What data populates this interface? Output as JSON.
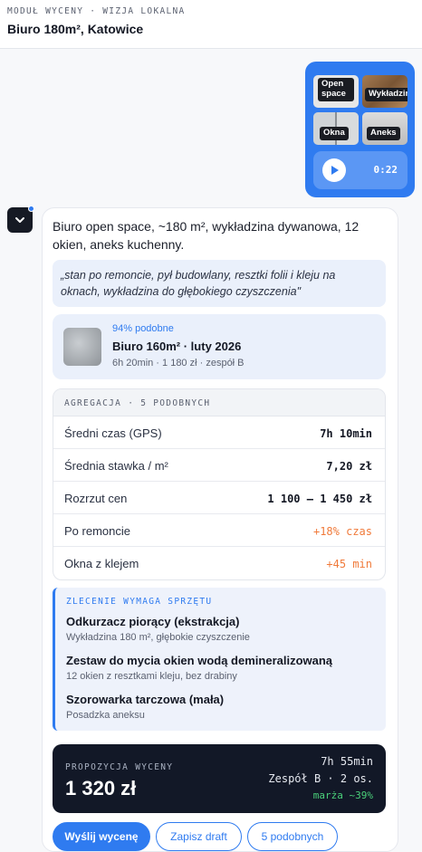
{
  "header": {
    "eyebrow": "MODUŁ WYCENY · WIZJA LOKALNA",
    "title": "Biuro 180m², Katowice"
  },
  "attachments": {
    "photos": [
      {
        "label": "Open space"
      },
      {
        "label": "Wykładzina"
      },
      {
        "label": "Okna"
      },
      {
        "label": "Aneks"
      }
    ],
    "audio": {
      "duration": "0:22"
    }
  },
  "assistant": {
    "intro": "Biuro open space, ~180 m², wykładzina dywanowa, 12 okien, aneks kuchenny.",
    "quote": "„stan po remoncie, pył budowlany, resztki folii i kleju na oknach, wykładzina do głębokiego czyszczenia\"",
    "match": {
      "similarity": "94% podobne",
      "name": "Biuro 160m² · luty 2026",
      "meta": "6h 20min · 1 180 zł · zespół B"
    },
    "aggregation": {
      "title": "AGREGACJA · 5 PODOBNYCH",
      "rows": [
        {
          "label": "Średni czas (GPS)",
          "value": "7h 10min"
        },
        {
          "label": "Średnia stawka / m²",
          "value": "7,20 zł"
        },
        {
          "label": "Rozrzut cen",
          "value": "1 100 – 1 450 zł"
        },
        {
          "label": "Po remoncie",
          "value": "+18% czas"
        },
        {
          "label": "Okna z klejem",
          "value": "+45 min"
        }
      ]
    },
    "equipment": {
      "title": "ZLECENIE WYMAGA SPRZĘTU",
      "items": [
        {
          "name": "Odkurzacz piorący (ekstrakcja)",
          "desc": "Wykładzina 180 m², głębokie czyszczenie"
        },
        {
          "name": "Zestaw do mycia okien wodą demineralizowaną",
          "desc": "12 okien z resztkami kleju, bez drabiny"
        },
        {
          "name": "Szorowarka tarczowa (mała)",
          "desc": "Posadzka aneksu"
        }
      ]
    },
    "proposal": {
      "label": "PROPOZYCJA WYCENY",
      "price": "1 320 zł",
      "time": "7h 55min",
      "team": "Zespół B · 2 os.",
      "margin": "marża ~39%"
    },
    "actions": {
      "send": "Wyślij wycenę",
      "draft": "Zapisz draft",
      "similar": "5 podobnych"
    }
  },
  "colors": {
    "accent": "#2f7bf0",
    "warning": "#f07a3a",
    "positive": "#4ad07a",
    "dark": "#121827"
  }
}
